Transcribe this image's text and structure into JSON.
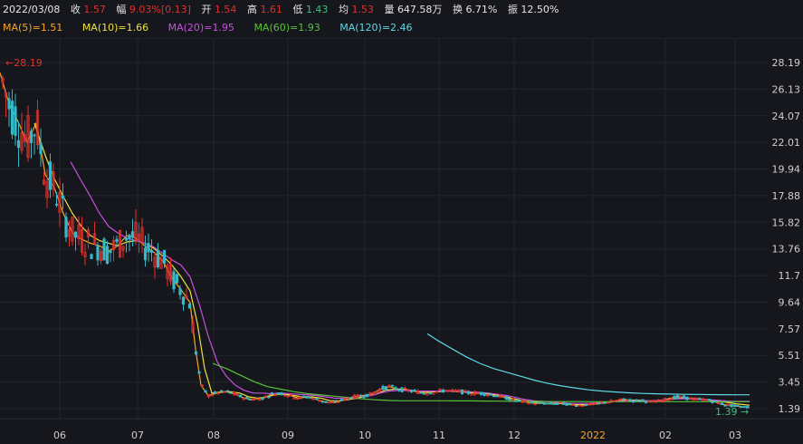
{
  "info": {
    "date": "2022/03/08",
    "close_label": "收",
    "close": "1.57",
    "range_label": "幅",
    "range": "9.03%[0.13]",
    "open_label": "开",
    "open": "1.54",
    "high_label": "高",
    "high": "1.61",
    "low_label": "低",
    "low": "1.43",
    "avg_label": "均",
    "avg": "1.53",
    "volume_label": "量",
    "volume": "647.58万",
    "turnover_label": "换",
    "turnover": "6.71%",
    "amplitude_label": "振",
    "amplitude": "12.50%"
  },
  "ma": [
    {
      "label": "MA(5)=1.51",
      "color": "#f5a623"
    },
    {
      "label": "MA(10)=1.66",
      "color": "#f0e040"
    },
    {
      "label": "MA(20)=1.95",
      "color": "#c850e0"
    },
    {
      "label": "MA(60)=1.93",
      "color": "#58c23a"
    },
    {
      "label": "MA(120)=2.46",
      "color": "#5fd8e8"
    }
  ],
  "colors": {
    "up": "#e0302d",
    "down": "#36b8c8",
    "value_up": "#e0302d",
    "value_down": "#3cc07a"
  },
  "chart_data": {
    "type": "candlestick",
    "y_ticks": [
      "28.19",
      "26.13",
      "24.07",
      "22.01",
      "19.94",
      "17.88",
      "15.82",
      "13.76",
      "11.7",
      "9.64",
      "7.57",
      "5.51",
      "3.45",
      "1.39"
    ],
    "y_range": [
      1.39,
      28.19
    ],
    "x_months": [
      "06",
      "07",
      "08",
      "09",
      "10",
      "11",
      "12",
      "2022",
      "02",
      "03"
    ],
    "high_annotation": "28.19",
    "low_annotation": "1.39",
    "ma_lines": {
      "MA(5)": {
        "color": "#f5a623",
        "points": [
          [
            0,
            27.4
          ],
          [
            10,
            25.0
          ],
          [
            20,
            23.6
          ],
          [
            30,
            22.0
          ],
          [
            40,
            23.5
          ],
          [
            50,
            19.5
          ],
          [
            60,
            18.5
          ],
          [
            70,
            16.5
          ],
          [
            80,
            15.0
          ],
          [
            90,
            14.5
          ],
          [
            100,
            14.2
          ],
          [
            110,
            14.0
          ],
          [
            120,
            13.6
          ],
          [
            130,
            14.0
          ],
          [
            140,
            14.8
          ],
          [
            150,
            14.6
          ],
          [
            160,
            14.0
          ],
          [
            170,
            13.5
          ],
          [
            180,
            12.8
          ],
          [
            190,
            11.5
          ],
          [
            200,
            10.6
          ],
          [
            210,
            9.6
          ],
          [
            216,
            6.0
          ],
          [
            222,
            3.2
          ],
          [
            230,
            2.4
          ],
          [
            240,
            2.6
          ],
          [
            250,
            2.7
          ],
          [
            260,
            2.5
          ],
          [
            270,
            2.2
          ],
          [
            280,
            2.1
          ],
          [
            290,
            2.2
          ],
          [
            300,
            2.5
          ],
          [
            310,
            2.6
          ],
          [
            320,
            2.4
          ],
          [
            330,
            2.2
          ],
          [
            340,
            2.3
          ],
          [
            350,
            2.1
          ],
          [
            360,
            1.9
          ],
          [
            370,
            1.85
          ],
          [
            380,
            2.1
          ],
          [
            390,
            2.3
          ],
          [
            400,
            2.4
          ],
          [
            410,
            2.5
          ],
          [
            420,
            2.9
          ],
          [
            430,
            3.1
          ],
          [
            440,
            2.9
          ],
          [
            450,
            2.8
          ],
          [
            460,
            2.7
          ],
          [
            470,
            2.6
          ],
          [
            480,
            2.7
          ],
          [
            490,
            2.8
          ],
          [
            500,
            2.75
          ],
          [
            510,
            2.7
          ],
          [
            520,
            2.6
          ],
          [
            530,
            2.6
          ],
          [
            540,
            2.5
          ],
          [
            550,
            2.4
          ],
          [
            560,
            2.2
          ],
          [
            570,
            2.0
          ],
          [
            580,
            1.9
          ],
          [
            590,
            1.8
          ],
          [
            600,
            1.8
          ],
          [
            610,
            1.75
          ],
          [
            620,
            1.8
          ],
          [
            630,
            1.7
          ],
          [
            640,
            1.65
          ],
          [
            650,
            1.7
          ],
          [
            660,
            1.75
          ],
          [
            670,
            1.9
          ],
          [
            680,
            2.0
          ],
          [
            690,
            2.1
          ],
          [
            700,
            2.0
          ],
          [
            710,
            2.0
          ],
          [
            720,
            1.9
          ],
          [
            730,
            2.0
          ],
          [
            740,
            2.2
          ],
          [
            750,
            2.3
          ],
          [
            760,
            2.2
          ],
          [
            770,
            2.1
          ],
          [
            780,
            2.1
          ],
          [
            790,
            1.9
          ],
          [
            800,
            1.7
          ],
          [
            810,
            1.6
          ],
          [
            818,
            1.55
          ],
          [
            828,
            1.51
          ]
        ]
      },
      "MA(10)": {
        "color": "#f0e040",
        "points": [
          [
            38,
            23.5
          ],
          [
            50,
            21.0
          ],
          [
            60,
            19.2
          ],
          [
            70,
            17.8
          ],
          [
            80,
            16.5
          ],
          [
            90,
            15.5
          ],
          [
            100,
            14.8
          ],
          [
            110,
            14.4
          ],
          [
            120,
            14.2
          ],
          [
            130,
            14.0
          ],
          [
            140,
            14.3
          ],
          [
            150,
            14.4
          ],
          [
            160,
            14.2
          ],
          [
            170,
            13.8
          ],
          [
            180,
            13.2
          ],
          [
            190,
            12.5
          ],
          [
            200,
            11.6
          ],
          [
            210,
            10.5
          ],
          [
            218,
            8.0
          ],
          [
            226,
            4.5
          ],
          [
            234,
            2.6
          ],
          [
            245,
            2.7
          ],
          [
            255,
            2.7
          ],
          [
            265,
            2.6
          ],
          [
            275,
            2.3
          ],
          [
            285,
            2.2
          ],
          [
            295,
            2.3
          ],
          [
            305,
            2.5
          ],
          [
            315,
            2.5
          ],
          [
            325,
            2.4
          ],
          [
            335,
            2.3
          ],
          [
            345,
            2.3
          ],
          [
            355,
            2.2
          ],
          [
            365,
            2.0
          ],
          [
            375,
            2.0
          ],
          [
            385,
            2.1
          ],
          [
            395,
            2.2
          ],
          [
            405,
            2.4
          ],
          [
            415,
            2.5
          ],
          [
            425,
            2.8
          ],
          [
            435,
            2.9
          ],
          [
            445,
            2.9
          ],
          [
            455,
            2.8
          ],
          [
            465,
            2.7
          ],
          [
            475,
            2.7
          ],
          [
            485,
            2.7
          ],
          [
            495,
            2.75
          ],
          [
            505,
            2.7
          ],
          [
            515,
            2.7
          ],
          [
            525,
            2.6
          ],
          [
            535,
            2.6
          ],
          [
            545,
            2.5
          ],
          [
            555,
            2.4
          ],
          [
            565,
            2.2
          ],
          [
            575,
            2.05
          ],
          [
            585,
            1.95
          ],
          [
            595,
            1.85
          ],
          [
            605,
            1.8
          ],
          [
            615,
            1.8
          ],
          [
            625,
            1.75
          ],
          [
            635,
            1.7
          ],
          [
            645,
            1.7
          ],
          [
            655,
            1.75
          ],
          [
            665,
            1.8
          ],
          [
            675,
            1.9
          ],
          [
            685,
            2.0
          ],
          [
            695,
            2.05
          ],
          [
            705,
            2.05
          ],
          [
            715,
            2.0
          ],
          [
            725,
            2.0
          ],
          [
            735,
            2.05
          ],
          [
            745,
            2.15
          ],
          [
            755,
            2.2
          ],
          [
            765,
            2.2
          ],
          [
            775,
            2.15
          ],
          [
            785,
            2.05
          ],
          [
            795,
            1.95
          ],
          [
            805,
            1.85
          ],
          [
            815,
            1.75
          ],
          [
            828,
            1.66
          ]
        ]
      },
      "MA(20)": {
        "color": "#c850e0",
        "points": [
          [
            78,
            20.5
          ],
          [
            90,
            19.0
          ],
          [
            100,
            17.8
          ],
          [
            110,
            16.5
          ],
          [
            120,
            15.5
          ],
          [
            130,
            15.0
          ],
          [
            140,
            14.6
          ],
          [
            150,
            14.4
          ],
          [
            160,
            14.2
          ],
          [
            170,
            13.9
          ],
          [
            180,
            13.4
          ],
          [
            190,
            12.9
          ],
          [
            200,
            12.5
          ],
          [
            210,
            11.6
          ],
          [
            220,
            9.5
          ],
          [
            230,
            7.0
          ],
          [
            240,
            5.0
          ],
          [
            250,
            3.9
          ],
          [
            260,
            3.2
          ],
          [
            270,
            2.8
          ],
          [
            280,
            2.6
          ],
          [
            290,
            2.6
          ],
          [
            300,
            2.55
          ],
          [
            310,
            2.6
          ],
          [
            320,
            2.55
          ],
          [
            330,
            2.5
          ],
          [
            340,
            2.45
          ],
          [
            350,
            2.4
          ],
          [
            360,
            2.3
          ],
          [
            370,
            2.2
          ],
          [
            380,
            2.2
          ],
          [
            390,
            2.25
          ],
          [
            400,
            2.35
          ],
          [
            410,
            2.4
          ],
          [
            420,
            2.6
          ],
          [
            430,
            2.75
          ],
          [
            440,
            2.8
          ],
          [
            450,
            2.8
          ],
          [
            460,
            2.75
          ],
          [
            470,
            2.75
          ],
          [
            480,
            2.75
          ],
          [
            490,
            2.75
          ],
          [
            500,
            2.75
          ],
          [
            510,
            2.72
          ],
          [
            520,
            2.7
          ],
          [
            530,
            2.65
          ],
          [
            540,
            2.6
          ],
          [
            550,
            2.5
          ],
          [
            560,
            2.4
          ],
          [
            570,
            2.25
          ],
          [
            580,
            2.1
          ],
          [
            590,
            2.0
          ],
          [
            600,
            1.95
          ],
          [
            610,
            1.9
          ],
          [
            620,
            1.85
          ],
          [
            630,
            1.8
          ],
          [
            640,
            1.8
          ],
          [
            650,
            1.8
          ],
          [
            660,
            1.85
          ],
          [
            670,
            1.9
          ],
          [
            680,
            1.95
          ],
          [
            690,
            2.0
          ],
          [
            700,
            2.0
          ],
          [
            710,
            2.0
          ],
          [
            720,
            2.0
          ],
          [
            730,
            2.05
          ],
          [
            740,
            2.1
          ],
          [
            750,
            2.15
          ],
          [
            760,
            2.15
          ],
          [
            770,
            2.1
          ],
          [
            780,
            2.1
          ],
          [
            790,
            2.05
          ],
          [
            800,
            2.0
          ],
          [
            810,
            1.95
          ],
          [
            820,
            1.95
          ],
          [
            828,
            1.95
          ]
        ]
      },
      "MA(60)": {
        "color": "#58c23a",
        "points": [
          [
            235,
            4.9
          ],
          [
            250,
            4.5
          ],
          [
            265,
            4.0
          ],
          [
            280,
            3.5
          ],
          [
            295,
            3.1
          ],
          [
            310,
            2.9
          ],
          [
            325,
            2.7
          ],
          [
            340,
            2.55
          ],
          [
            355,
            2.45
          ],
          [
            370,
            2.35
          ],
          [
            385,
            2.25
          ],
          [
            400,
            2.15
          ],
          [
            415,
            2.08
          ],
          [
            430,
            2.02
          ],
          [
            445,
            2.0
          ],
          [
            460,
            2.0
          ],
          [
            475,
            2.0
          ],
          [
            490,
            2.0
          ],
          [
            505,
            1.99
          ],
          [
            520,
            1.99
          ],
          [
            535,
            1.98
          ],
          [
            550,
            1.97
          ],
          [
            565,
            1.96
          ],
          [
            580,
            1.95
          ],
          [
            595,
            1.95
          ],
          [
            610,
            1.94
          ],
          [
            625,
            1.94
          ],
          [
            640,
            1.94
          ],
          [
            655,
            1.93
          ],
          [
            670,
            1.93
          ],
          [
            685,
            1.93
          ],
          [
            700,
            1.93
          ],
          [
            715,
            1.93
          ],
          [
            730,
            1.93
          ],
          [
            745,
            1.93
          ],
          [
            760,
            1.93
          ],
          [
            775,
            1.93
          ],
          [
            790,
            1.93
          ],
          [
            805,
            1.93
          ],
          [
            828,
            1.93
          ]
        ]
      },
      "MA(120)": {
        "color": "#5fd8e8",
        "points": [
          [
            472,
            7.2
          ],
          [
            485,
            6.6
          ],
          [
            500,
            6.0
          ],
          [
            515,
            5.4
          ],
          [
            530,
            4.9
          ],
          [
            545,
            4.5
          ],
          [
            560,
            4.2
          ],
          [
            575,
            3.9
          ],
          [
            590,
            3.6
          ],
          [
            605,
            3.35
          ],
          [
            620,
            3.15
          ],
          [
            635,
            3.0
          ],
          [
            650,
            2.85
          ],
          [
            665,
            2.75
          ],
          [
            680,
            2.68
          ],
          [
            695,
            2.62
          ],
          [
            710,
            2.57
          ],
          [
            725,
            2.54
          ],
          [
            740,
            2.52
          ],
          [
            755,
            2.5
          ],
          [
            770,
            2.49
          ],
          [
            785,
            2.48
          ],
          [
            800,
            2.47
          ],
          [
            815,
            2.46
          ],
          [
            828,
            2.46
          ]
        ]
      }
    }
  }
}
